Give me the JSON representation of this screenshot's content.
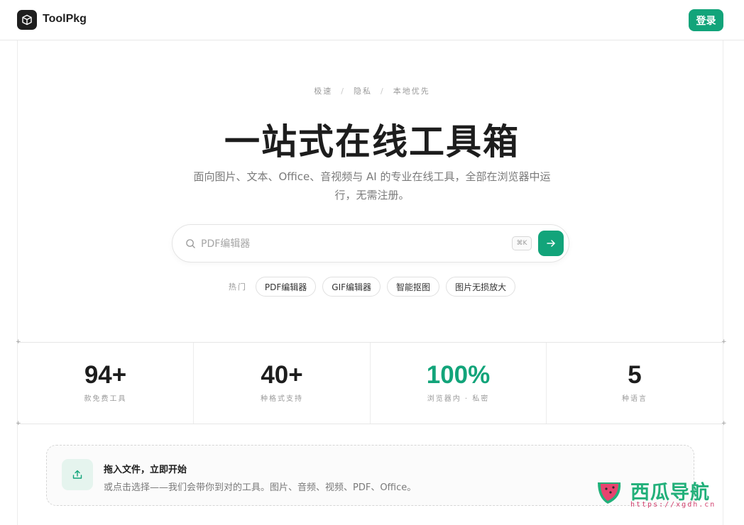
{
  "header": {
    "brand": "ToolPkg",
    "login_label": "登录"
  },
  "hero": {
    "tags": [
      "极速",
      "隐私",
      "本地优先"
    ],
    "tag_separator": "/",
    "title": "一站式在线工具箱",
    "subtitle": "面向图片、文本、Office、音视频与 AI 的专业在线工具，全部在浏览器中运行，无需注册。"
  },
  "search": {
    "placeholder": "PDF编辑器",
    "shortcut": "⌘K"
  },
  "hot": {
    "label": "热门",
    "items": [
      "PDF编辑器",
      "GIF编辑器",
      "智能抠图",
      "图片无损放大"
    ]
  },
  "stats": [
    {
      "value": "94+",
      "label": "款免费工具",
      "accent": false
    },
    {
      "value": "40+",
      "label": "种格式支持",
      "accent": false
    },
    {
      "value": "100%",
      "label": "浏览器内 · 私密",
      "accent": true
    },
    {
      "value": "5",
      "label": "种语言",
      "accent": false
    }
  ],
  "dropzone": {
    "title": "拖入文件，立即开始",
    "description": "或点击选择——我们会带你到对的工具。图片、音频、视频、PDF、Office。"
  },
  "watermark": {
    "text": "西瓜导航",
    "url": "https://xgdh.cn"
  },
  "colors": {
    "accent": "#12a47a",
    "brand_dark": "#1e1e1e"
  }
}
